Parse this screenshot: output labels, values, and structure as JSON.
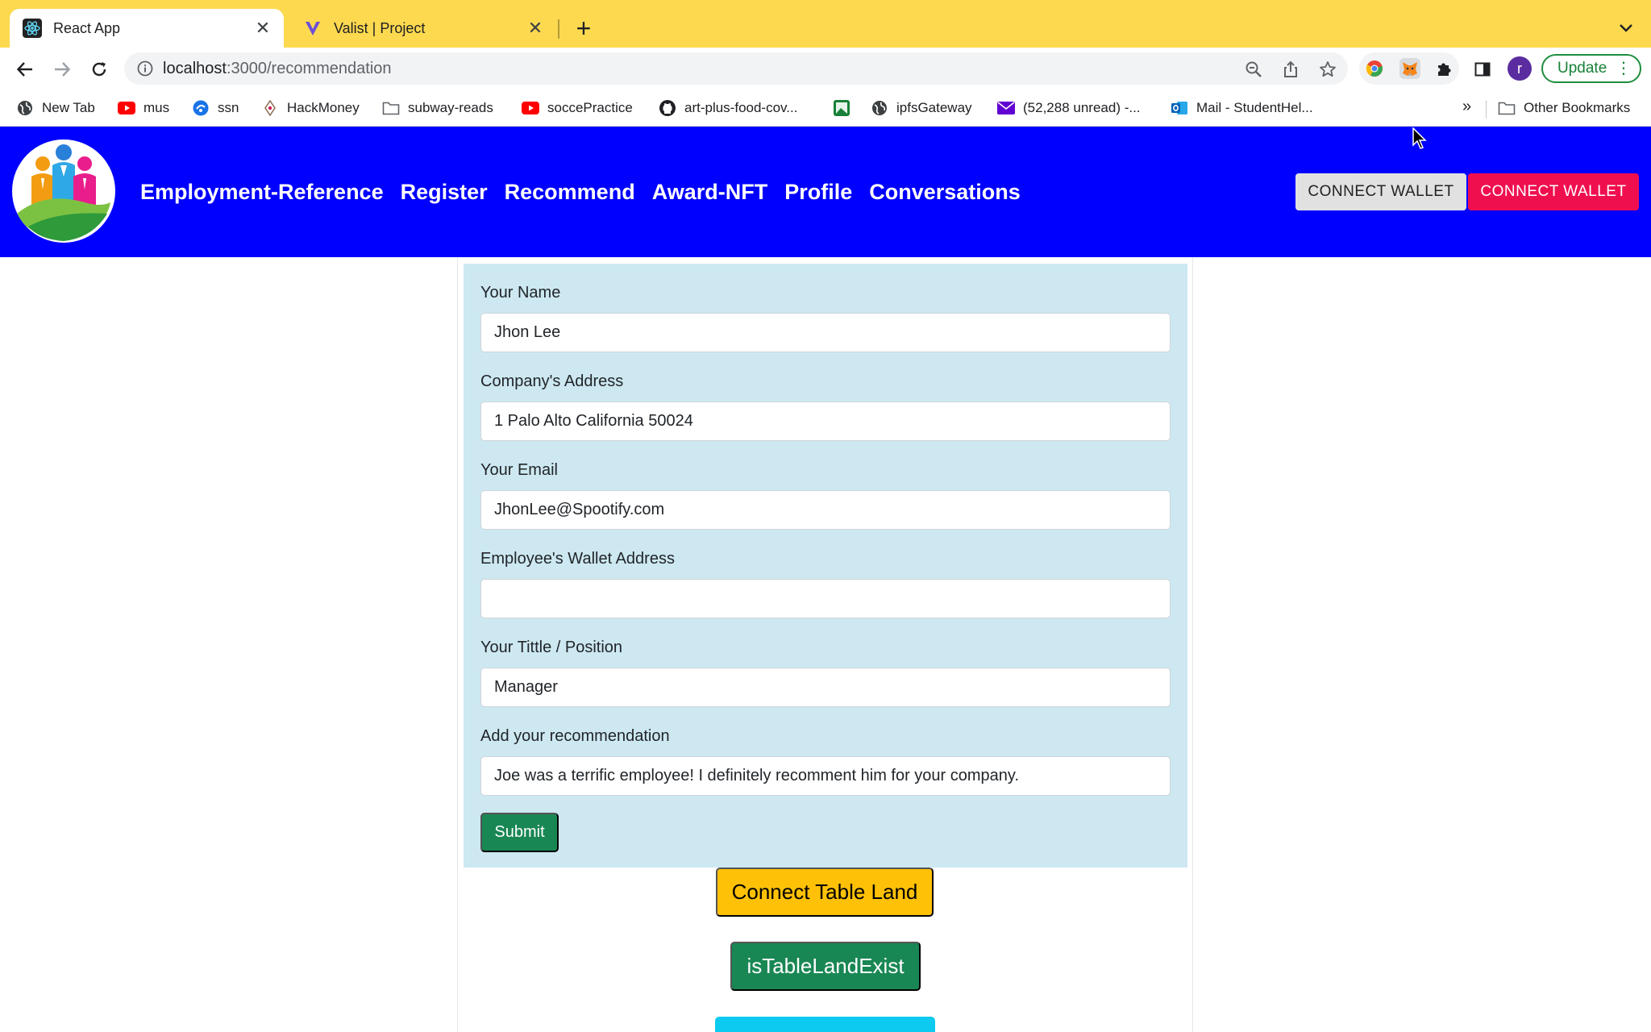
{
  "browser": {
    "tabs": [
      {
        "title": "React App",
        "active": true
      },
      {
        "title": "Valist | Project",
        "active": false
      }
    ],
    "address": {
      "host": "localhost",
      "path": ":3000/recommendation"
    },
    "update_label": "Update",
    "profile_initial": "r",
    "bookmarks": [
      {
        "label": "New Tab",
        "icon": "globe-icon"
      },
      {
        "label": "mus",
        "icon": "youtube-icon"
      },
      {
        "label": "ssn",
        "icon": "app-icon"
      },
      {
        "label": "HackMoney",
        "icon": "ethglobal-icon"
      },
      {
        "label": "subway-reads",
        "icon": "folder-icon"
      },
      {
        "label": "soccePractice",
        "icon": "youtube-icon"
      },
      {
        "label": "art-plus-food-cov...",
        "icon": "github-icon"
      },
      {
        "label": "",
        "icon": "image-icon"
      },
      {
        "label": "ipfsGateway",
        "icon": "globe-icon"
      },
      {
        "label": "(52,288 unread) -...",
        "icon": "mail-icon"
      },
      {
        "label": "Mail - StudentHel...",
        "icon": "outlook-icon"
      }
    ],
    "bookmarks_more": "»",
    "other_bookmarks": "Other Bookmarks"
  },
  "app": {
    "nav": [
      "Employment-Reference",
      "Register",
      "Recommend",
      "Award-NFT",
      "Profile",
      "Conversations"
    ],
    "connect_wallet_grey": "CONNECT WALLET",
    "connect_wallet_red": "CONNECT WALLET"
  },
  "form": {
    "fields": [
      {
        "label": "Your Name",
        "value": "Jhon Lee"
      },
      {
        "label": "Company's Address",
        "value": "1 Palo Alto California 50024"
      },
      {
        "label": "Your Email",
        "value": "JhonLee@Spootify.com"
      },
      {
        "label": "Employee's Wallet Address",
        "value": ""
      },
      {
        "label": "Your Tittle / Position",
        "value": "Manager"
      },
      {
        "label": "Add your recommendation",
        "value": "Joe was a terrific employee! I definitely recomment him for your company."
      }
    ],
    "submit_label": "Submit"
  },
  "actions": {
    "connect_tableland": "Connect Table Land",
    "is_tableland_exist": "isTableLandExist"
  },
  "colors": {
    "tabstrip": "#fcd94f",
    "appbar": "#0000fe",
    "form_bg": "#cde8f1",
    "success": "#198754",
    "warning": "#ffc107",
    "danger_wallet": "#ef0f4f",
    "info": "#0dcaf0"
  }
}
